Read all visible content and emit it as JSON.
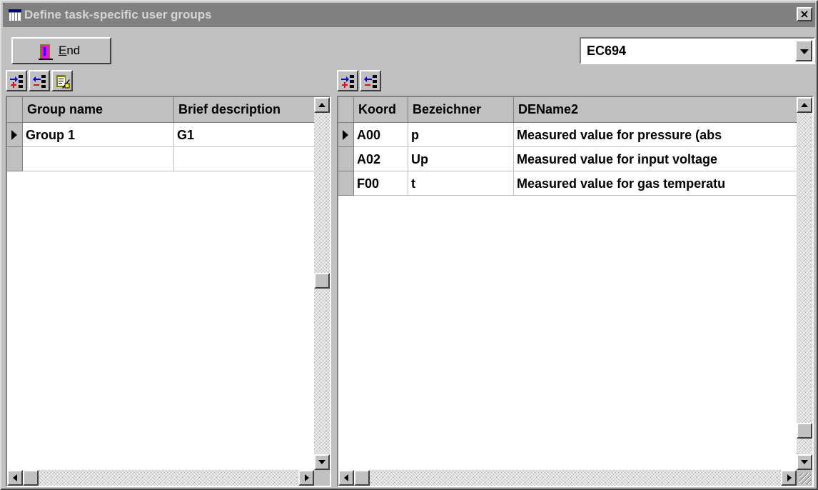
{
  "window": {
    "title": "Define task-specific user groups",
    "close_glyph": "×"
  },
  "toolbar": {
    "end_button": {
      "mnemonic": "E",
      "label_rest": "nd",
      "icon": "exit-door-icon"
    },
    "selector": {
      "value": "EC694"
    }
  },
  "left_grid": {
    "toolbar_icons": [
      "insert-row-icon",
      "delete-row-icon",
      "edit-clipboard-icon"
    ],
    "columns": [
      "Group name",
      "Brief description"
    ],
    "rows": [
      {
        "cells": [
          "Group 1",
          "G1"
        ],
        "current": true
      },
      {
        "cells": [
          "",
          ""
        ],
        "current": false
      }
    ]
  },
  "right_grid": {
    "toolbar_icons": [
      "insert-row-icon",
      "delete-row-icon"
    ],
    "columns": [
      "Koord",
      "Bezeichner",
      "DEName2"
    ],
    "rows": [
      {
        "cells": [
          "A00",
          "p",
          "Measured value for pressure (abs"
        ],
        "current": true
      },
      {
        "cells": [
          "A02",
          "Up",
          "Measured value for input voltage"
        ],
        "current": false
      },
      {
        "cells": [
          "F00",
          "t",
          "Measured value for gas temperatu"
        ],
        "current": false
      }
    ]
  },
  "colors": {
    "titlebar_inactive": "#808080",
    "face": "#c0c0c0",
    "icon_red": "#ff0000",
    "icon_blue": "#0000ff"
  }
}
